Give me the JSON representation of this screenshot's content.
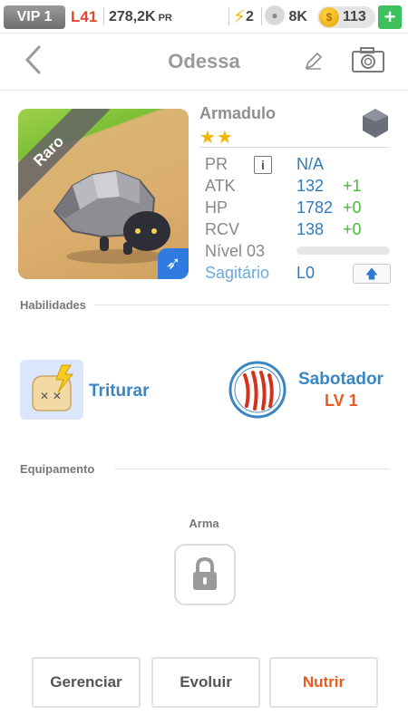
{
  "status_bar": {
    "vip": "VIP 1",
    "level": "L41",
    "power": "278,2K",
    "power_unit": "PR",
    "energy": "2",
    "paw_count": "8K",
    "coins": "113",
    "add_label": "+"
  },
  "header": {
    "title": "Odessa"
  },
  "creature": {
    "rarity": "Raro",
    "name": "Armadulo",
    "stars": "★★",
    "stats": {
      "pr_label": "PR",
      "pr_value": "N/A",
      "atk_label": "ATK",
      "atk_value": "132",
      "atk_bonus": "+1",
      "hp_label": "HP",
      "hp_value": "1782",
      "hp_bonus": "+0",
      "rcv_label": "RCV",
      "rcv_value": "138",
      "rcv_bonus": "+0",
      "level_label": "Nível 03",
      "level_progress": 0.0,
      "sign_label": "Sagitário",
      "sign_value": "L0"
    }
  },
  "abilities": {
    "title": "Habilidades",
    "skill_name": "Triturar",
    "ability_name": "Sabotador",
    "ability_level": "LV 1"
  },
  "equipment": {
    "title": "Equipamento",
    "weapon_label": "Arma"
  },
  "actions": {
    "manage": "Gerenciar",
    "evolve": "Evoluir",
    "feed": "Nutrir"
  },
  "colors": {
    "accent_blue": "#3a86c3",
    "bonus_green": "#4cbb3c",
    "level_red": "#e5462a",
    "feed_orange": "#ec5a1e"
  }
}
